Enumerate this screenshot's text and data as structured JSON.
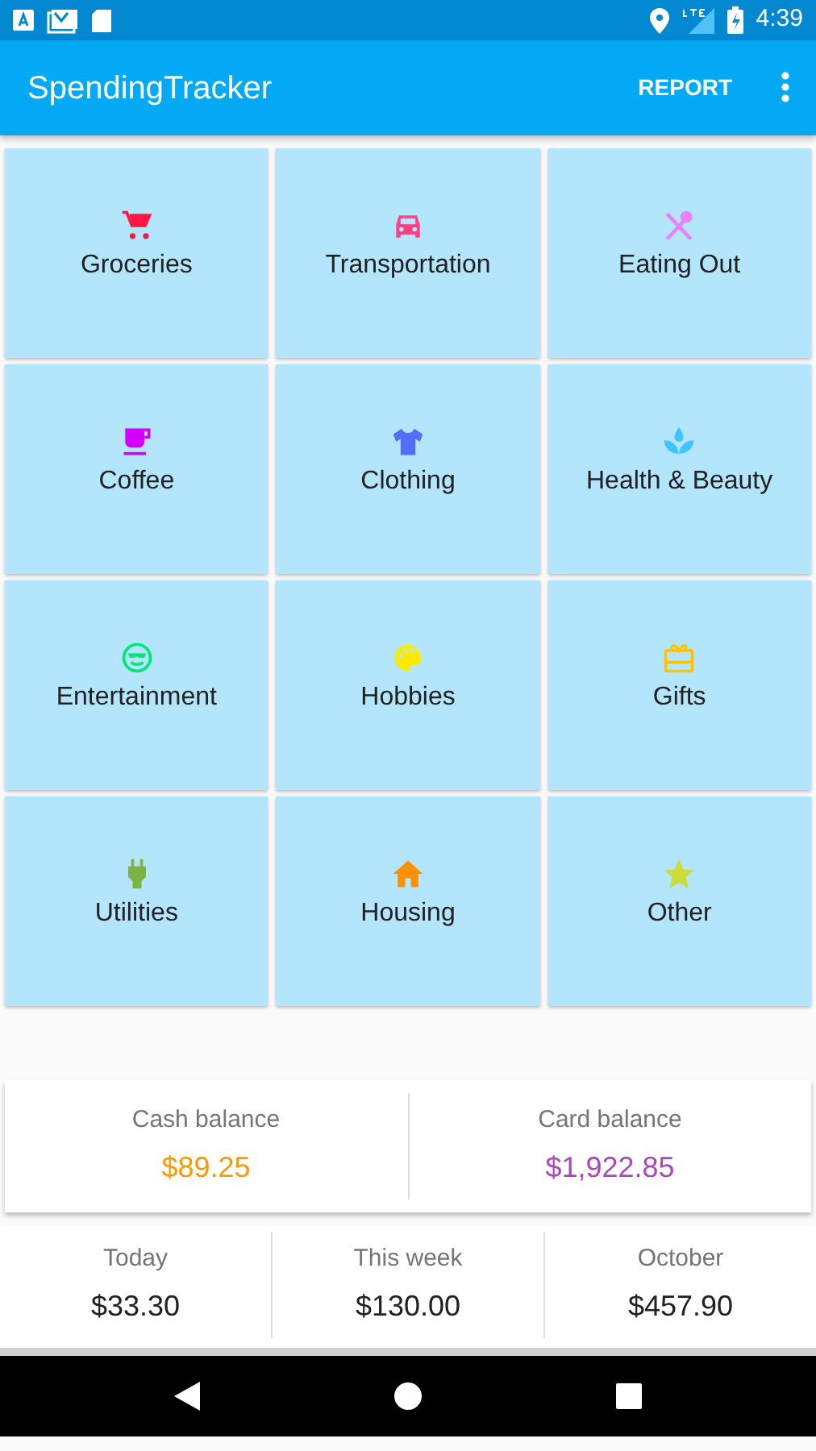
{
  "status_bar": {
    "time": "4:39"
  },
  "app_bar": {
    "title": "SpendingTracker",
    "action": "REPORT"
  },
  "categories": [
    {
      "label": "Groceries",
      "color": "#ff1744"
    },
    {
      "label": "Transportation",
      "color": "#ff4081"
    },
    {
      "label": "Eating Out",
      "color": "#ea80fc"
    },
    {
      "label": "Coffee",
      "color": "#d500f9"
    },
    {
      "label": "Clothing",
      "color": "#536dfe"
    },
    {
      "label": "Health & Beauty",
      "color": "#40c4ff"
    },
    {
      "label": "Entertainment",
      "color": "#00e676"
    },
    {
      "label": "Hobbies",
      "color": "#ffea00"
    },
    {
      "label": "Gifts",
      "color": "#ffc400"
    },
    {
      "label": "Utilities",
      "color": "#7cb342"
    },
    {
      "label": "Housing",
      "color": "#ff9100"
    },
    {
      "label": "Other",
      "color": "#cddc39"
    }
  ],
  "balances": [
    {
      "label": "Cash balance",
      "value": "$89.25",
      "color": "#ff9800"
    },
    {
      "label": "Card balance",
      "value": "$1,922.85",
      "color": "#ab47bc"
    }
  ],
  "totals": [
    {
      "label": "Today",
      "value": "$33.30"
    },
    {
      "label": "This week",
      "value": "$130.00"
    },
    {
      "label": "October",
      "value": "$457.90"
    }
  ]
}
